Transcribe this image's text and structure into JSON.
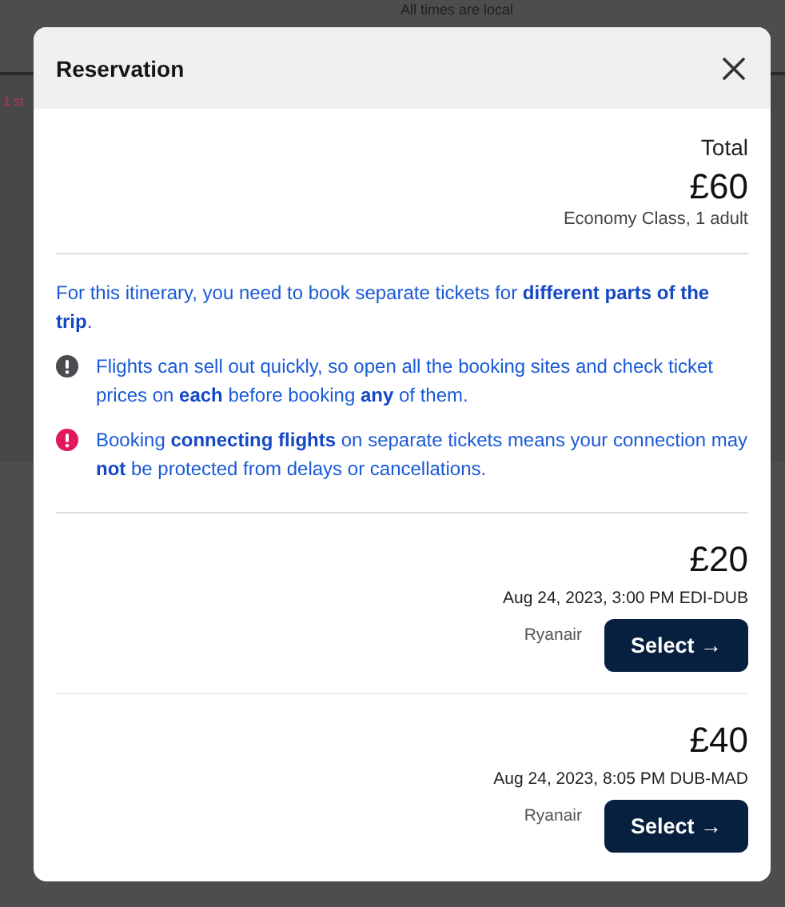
{
  "background": {
    "note": "All times are local",
    "stops": "1 st"
  },
  "dialog": {
    "title": "Reservation",
    "total": {
      "label": "Total",
      "price": "£60",
      "detail": "Economy Class, 1 adult"
    },
    "notices": [
      {
        "kind": "plain",
        "text": "For this itinerary, you need to book separate tickets for **different parts of the trip**."
      },
      {
        "kind": "caution",
        "text": "Flights can sell out quickly, so open all the booking sites and check ticket prices on **each** before booking **any** of them."
      },
      {
        "kind": "alert",
        "text": "Booking **connecting flights** on separate tickets means your connection may **not** be protected from delays or cancellations."
      }
    ],
    "tickets": [
      {
        "price": "£20",
        "flight": "Aug 24, 2023, 3:00 PM EDI-DUB",
        "airline": "Ryanair",
        "button": "Select →"
      },
      {
        "price": "£40",
        "flight": "Aug 24, 2023, 8:05 PM DUB-MAD",
        "airline": "Ryanair",
        "button": "Select →"
      }
    ]
  }
}
